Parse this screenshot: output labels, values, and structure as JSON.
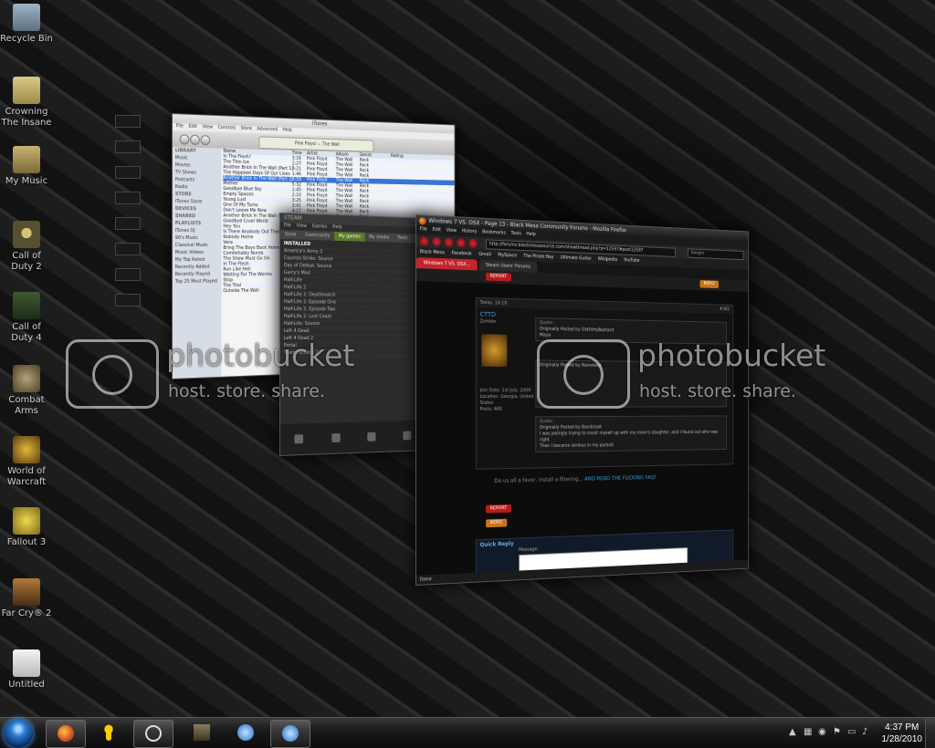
{
  "desktop": {
    "icons": [
      {
        "label": "Recycle Bin",
        "icon": "recycle-bin-icon"
      },
      {
        "label": "Crowning The Insane",
        "icon": "folder-icon"
      },
      {
        "label": "My Music",
        "icon": "music-folder-icon"
      },
      {
        "label": "Call of Duty 2",
        "icon": "call-of-duty-2-icon"
      },
      {
        "label": "Call of Duty 4",
        "icon": "call-of-duty-4-icon"
      },
      {
        "label": "Combat Arms",
        "icon": "combat-arms-icon"
      },
      {
        "label": "World of Warcraft",
        "icon": "world-of-warcraft-icon"
      },
      {
        "label": "Fallout 3",
        "icon": "fallout-3-icon"
      },
      {
        "label": "Far Cry® 2",
        "icon": "far-cry-2-icon"
      },
      {
        "label": "Untitled",
        "icon": "document-icon"
      }
    ]
  },
  "itunes": {
    "title": "iTunes",
    "menu": [
      "File",
      "Edit",
      "View",
      "Controls",
      "Store",
      "Advanced",
      "Help"
    ],
    "lcd_line1": "Pink Floyd",
    "lcd_line2": "The Wall",
    "sidebar": [
      "LIBRARY",
      "Music",
      "Movies",
      "TV Shows",
      "Podcasts",
      "Radio",
      "STORE",
      "iTunes Store",
      "DEVICES",
      "SHARED",
      "PLAYLISTS",
      "iTunes DJ",
      "90's Music",
      "Classical Music",
      "Music Videos",
      "My Top Rated",
      "Recently Added",
      "Recently Played",
      "Top 25 Most Played"
    ],
    "headers": [
      "Name",
      "Time",
      "Artist",
      "Album",
      "Genre",
      "Rating"
    ],
    "tracks": [
      {
        "name": "In The Flesh?",
        "time": "3:16",
        "artist": "Pink Floyd",
        "album": "The Wall",
        "genre": "Rock"
      },
      {
        "name": "The Thin Ice",
        "time": "2:27",
        "artist": "Pink Floyd",
        "album": "The Wall",
        "genre": "Rock"
      },
      {
        "name": "Another Brick In The Wall (Part 1)",
        "time": "3:21",
        "artist": "Pink Floyd",
        "album": "The Wall",
        "genre": "Rock"
      },
      {
        "name": "The Happiest Days Of Our Lives",
        "time": "1:46",
        "artist": "Pink Floyd",
        "album": "The Wall",
        "genre": "Rock"
      },
      {
        "name": "Another Brick In The Wall (Part 2)",
        "time": "3:59",
        "artist": "Pink Floyd",
        "album": "The Wall",
        "genre": "Rock"
      },
      {
        "name": "Mother",
        "time": "5:32",
        "artist": "Pink Floyd",
        "album": "The Wall",
        "genre": "Rock"
      },
      {
        "name": "Goodbye Blue Sky",
        "time": "2:45",
        "artist": "Pink Floyd",
        "album": "The Wall",
        "genre": "Rock"
      },
      {
        "name": "Empty Spaces",
        "time": "2:10",
        "artist": "Pink Floyd",
        "album": "The Wall",
        "genre": "Rock"
      },
      {
        "name": "Young Lust",
        "time": "3:25",
        "artist": "Pink Floyd",
        "album": "The Wall",
        "genre": "Rock"
      },
      {
        "name": "One Of My Turns",
        "time": "3:41",
        "artist": "Pink Floyd",
        "album": "The Wall",
        "genre": "Rock"
      },
      {
        "name": "Don't Leave Me Now",
        "time": "4:17",
        "artist": "Pink Floyd",
        "album": "The Wall",
        "genre": "Rock"
      },
      {
        "name": "Another Brick In The Wall (Part 3)",
        "time": "1:18",
        "artist": "Pink Floyd",
        "album": "The Wall",
        "genre": "Rock"
      },
      {
        "name": "Goodbye Cruel World",
        "time": "1:16",
        "artist": "Pink Floyd",
        "album": "The Wall",
        "genre": "Rock"
      },
      {
        "name": "Hey You",
        "time": "4:40",
        "artist": "Pink Floyd",
        "album": "The Wall",
        "genre": "Rock"
      },
      {
        "name": "Is There Anybody Out There?",
        "time": "2:44",
        "artist": "Pink Floyd",
        "album": "The Wall",
        "genre": "Rock"
      },
      {
        "name": "Nobody Home",
        "time": "3:26",
        "artist": "Pink Floyd",
        "album": "The Wall",
        "genre": "Rock"
      },
      {
        "name": "Vera",
        "time": "1:35",
        "artist": "Pink Floyd",
        "album": "The Wall",
        "genre": "Rock"
      },
      {
        "name": "Bring The Boys Back Home",
        "time": "1:21",
        "artist": "Pink Floyd",
        "album": "The Wall",
        "genre": "Rock"
      },
      {
        "name": "Comfortably Numb",
        "time": "6:24",
        "artist": "Pink Floyd",
        "album": "The Wall",
        "genre": "Rock"
      },
      {
        "name": "The Show Must Go On",
        "time": "1:36",
        "artist": "Pink Floyd",
        "album": "The Wall",
        "genre": "Rock"
      },
      {
        "name": "In The Flesh",
        "time": "4:16",
        "artist": "Pink Floyd",
        "album": "The Wall",
        "genre": "Rock"
      },
      {
        "name": "Run Like Hell",
        "time": "4:20",
        "artist": "Pink Floyd",
        "album": "The Wall",
        "genre": "Rock"
      },
      {
        "name": "Waiting For The Worms",
        "time": "4:04",
        "artist": "Pink Floyd",
        "album": "The Wall",
        "genre": "Rock"
      },
      {
        "name": "Stop",
        "time": "0:30",
        "artist": "Pink Floyd",
        "album": "The Wall",
        "genre": "Rock"
      },
      {
        "name": "The Trial",
        "time": "5:13",
        "artist": "Pink Floyd",
        "album": "The Wall",
        "genre": "Rock"
      },
      {
        "name": "Outside The Wall",
        "time": "1:41",
        "artist": "Pink Floyd",
        "album": "The Wall",
        "genre": "Rock"
      }
    ]
  },
  "steam": {
    "title": "STEAM",
    "menu": [
      "File",
      "View",
      "Games",
      "Help"
    ],
    "tabs": [
      "Store",
      "Community",
      "My games",
      "My media",
      "Tools"
    ],
    "active_tab": "My games",
    "list_header": "INSTALLED",
    "games": [
      "America's Army 3",
      "Counter-Strike: Source",
      "Day of Defeat: Source",
      "Garry's Mod",
      "Half-Life",
      "Half-Life 2",
      "Half-Life 2: Deathmatch",
      "Half-Life 2: Episode One",
      "Half-Life 2: Episode Two",
      "Half-Life 2: Lost Coast",
      "Half-Life: Source",
      "Left 4 Dead",
      "Left 4 Dead 2",
      "Portal",
      "Team Fortress 2"
    ]
  },
  "firefox": {
    "title": "Windows 7 VS. OSX - Page 13 - Black Mesa Community Forums - Mozilla Firefox",
    "menu": [
      "File",
      "Edit",
      "View",
      "History",
      "Bookmarks",
      "Tools",
      "Help"
    ],
    "url": "http://forums.blackmesasource.com/showthread.php?p=12597#post12597",
    "search_placeholder": "Google",
    "bookmarks": [
      "Black Mesa",
      "Facebook",
      "Gmail",
      "MySpace",
      "The Pirate Bay",
      "Ultimate Guitar",
      "Wikipedia",
      "YouTube"
    ],
    "tabs": [
      "Windows 7 VS. OSX...",
      "Steam Users' Forums"
    ],
    "report_label": "REPORT",
    "reply_label": "REPLY",
    "post_date": "Today, 16:18",
    "post_number": "#382",
    "username": "CTTD",
    "user_title": "Zombie",
    "user_info": [
      "Join Date: 1st July, 2009",
      "Location: Georgia, United",
      "States",
      "Posts: 468"
    ],
    "quote1_header": "Quote:",
    "quote1_text": "Originally Posted by OldDirtyBastard",
    "quote1_body": "Maya",
    "quote2_text": "Originally Posted by Nameless",
    "quote3_header": "Quote:",
    "quote3_text": "Originally Posted by Bandicoot",
    "quote3_body": "I was jokingly trying to insult myself up with my mom's daughter, and I found out who was right.",
    "quote3_body2": "Then I became serious in my pursuit.",
    "footer_text": "Do us all a favor, install a filtering...",
    "footer_link": "AND READ THE FUCKING FAQ!",
    "quick_reply": "Quick Reply",
    "message_label": "Message:",
    "status": "Done"
  },
  "watermark": {
    "brand": "photobucket",
    "tagline": "host. store. share."
  },
  "taskbar": {
    "pinned": [
      "firefox-icon",
      "aim-icon",
      "steam-icon",
      "call-of-duty-icon",
      "itunes-icon",
      "itunes-icon"
    ],
    "time": "4:37 PM",
    "date": "1/28/2010"
  }
}
